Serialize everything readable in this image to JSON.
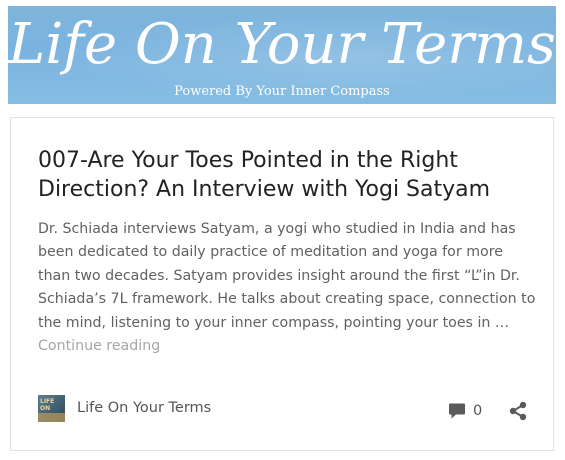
{
  "site": {
    "title": "Life On Your Terms",
    "tagline": "Powered By Your Inner Compass"
  },
  "post": {
    "title": "007-Are Your Toes Pointed in the Right Direction? An Interview with Yogi Satyam",
    "excerpt": "Dr. Schiada interviews Satyam, a yogi who studied in India and has been dedicated to daily practice of meditation and yoga for more than two decades. Satyam provides insight around the first “L”in Dr. Schiada’s 7L framework. He talks about creating space, connection to the mind, listening to your inner compass, pointing your toes in … ",
    "continue_label": "Continue reading",
    "author": {
      "name": "Life On Your Terms",
      "avatar_text": "LIFE ON"
    },
    "comment_count": "0"
  },
  "icons": {
    "comment": "comment-icon",
    "share": "share-icon"
  },
  "colors": {
    "banner_blue": "#7ab3df",
    "title_text": "#222222",
    "body_text": "#616161",
    "muted_link": "#a6a6a6",
    "icon_gray": "#5a5a5a"
  }
}
